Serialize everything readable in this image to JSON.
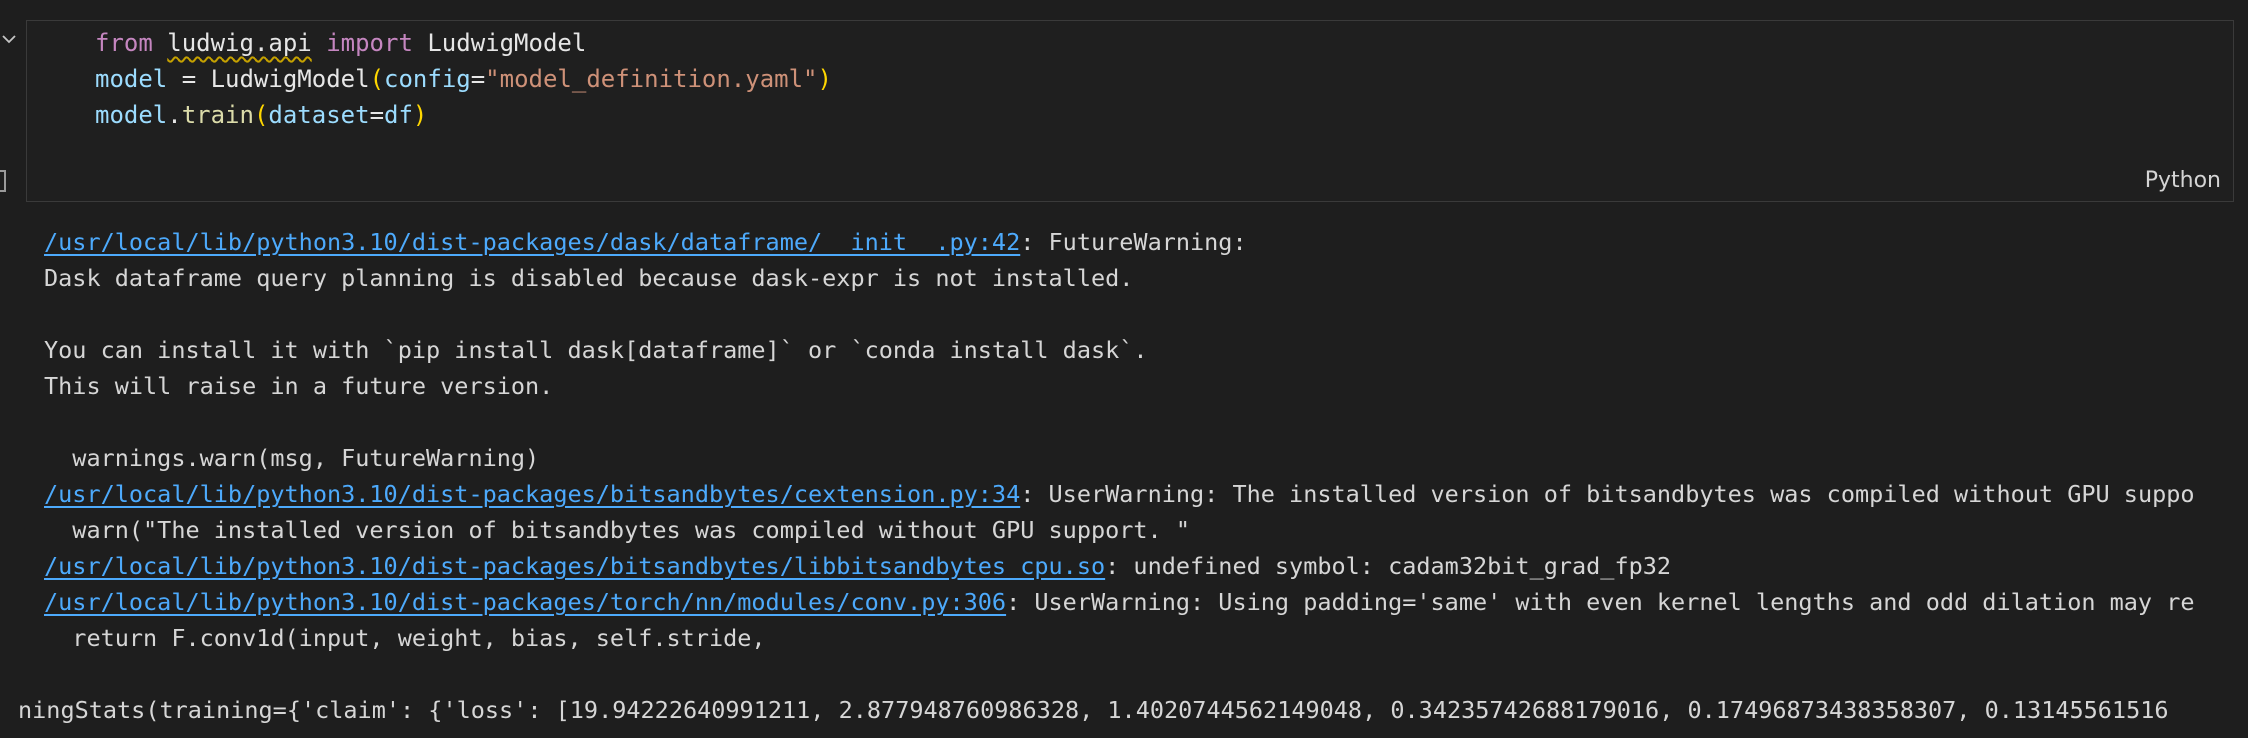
{
  "cell": {
    "code_lines": [
      [
        {
          "t": "from",
          "c": "kw"
        },
        {
          "t": " ",
          "c": "op"
        },
        {
          "t": "ludwig.api",
          "c": "mod"
        },
        {
          "t": " ",
          "c": "op"
        },
        {
          "t": "import",
          "c": "kw"
        },
        {
          "t": " LudwigModel",
          "c": "name"
        }
      ],
      [
        {
          "t": "model",
          "c": "var"
        },
        {
          "t": " = ",
          "c": "op"
        },
        {
          "t": "LudwigModel",
          "c": "name"
        },
        {
          "t": "(",
          "c": "paren"
        },
        {
          "t": "config",
          "c": "var"
        },
        {
          "t": "=",
          "c": "op"
        },
        {
          "t": "\"model_definition.yaml\"",
          "c": "str"
        },
        {
          "t": ")",
          "c": "paren"
        }
      ],
      [
        {
          "t": "model",
          "c": "var"
        },
        {
          "t": ".",
          "c": "op"
        },
        {
          "t": "train",
          "c": "fn"
        },
        {
          "t": "(",
          "c": "paren"
        },
        {
          "t": "dataset",
          "c": "var"
        },
        {
          "t": "=",
          "c": "op"
        },
        {
          "t": "df",
          "c": "var"
        },
        {
          "t": ")",
          "c": "paren"
        }
      ]
    ],
    "language": "Python"
  },
  "output": {
    "lines": [
      {
        "link": "/usr/local/lib/python3.10/dist-packages/dask/dataframe/__init__.py:42",
        "text": ": FutureWarning:"
      },
      {
        "text": "Dask dataframe query planning is disabled because dask-expr is not installed."
      },
      {
        "text": ""
      },
      {
        "text": "You can install it with `pip install dask[dataframe]` or `conda install dask`."
      },
      {
        "text": "This will raise in a future version."
      },
      {
        "text": ""
      },
      {
        "text": "  warnings.warn(msg, FutureWarning)"
      },
      {
        "link": "/usr/local/lib/python3.10/dist-packages/bitsandbytes/cextension.py:34",
        "text": ": UserWarning: The installed version of bitsandbytes was compiled without GPU suppo"
      },
      {
        "text": "  warn(\"The installed version of bitsandbytes was compiled without GPU support. \""
      },
      {
        "link": "/usr/local/lib/python3.10/dist-packages/bitsandbytes/libbitsandbytes_cpu.so",
        "text": ": undefined symbol: cadam32bit_grad_fp32"
      },
      {
        "link": "/usr/local/lib/python3.10/dist-packages/torch/nn/modules/conv.py:306",
        "text": ": UserWarning: Using padding='same' with even kernel lengths and odd dilation may re"
      },
      {
        "text": "  return F.conv1d(input, weight, bias, self.stride,"
      },
      {
        "text": ""
      },
      {
        "text": "ningStats(training={'claim': {'loss': [19.94222640991211, 2.877948760986328, 1.4020744562149048, 0.34235742688179016, 0.17496873438358307, 0.13145561516",
        "indent": -12
      }
    ]
  },
  "colors": {
    "background": "#1e1e1e",
    "cell_background": "#1f1f1f",
    "cell_border": "#3a3a3a",
    "link": "#4daafc",
    "keyword": "#c586c0",
    "variable": "#9cdcfe",
    "function": "#dcdcaa",
    "string": "#ce9178",
    "bracket": "#ffd700"
  },
  "icons": {
    "collapse": "chevron-down-icon",
    "execution": "execution-bracket-icon"
  }
}
